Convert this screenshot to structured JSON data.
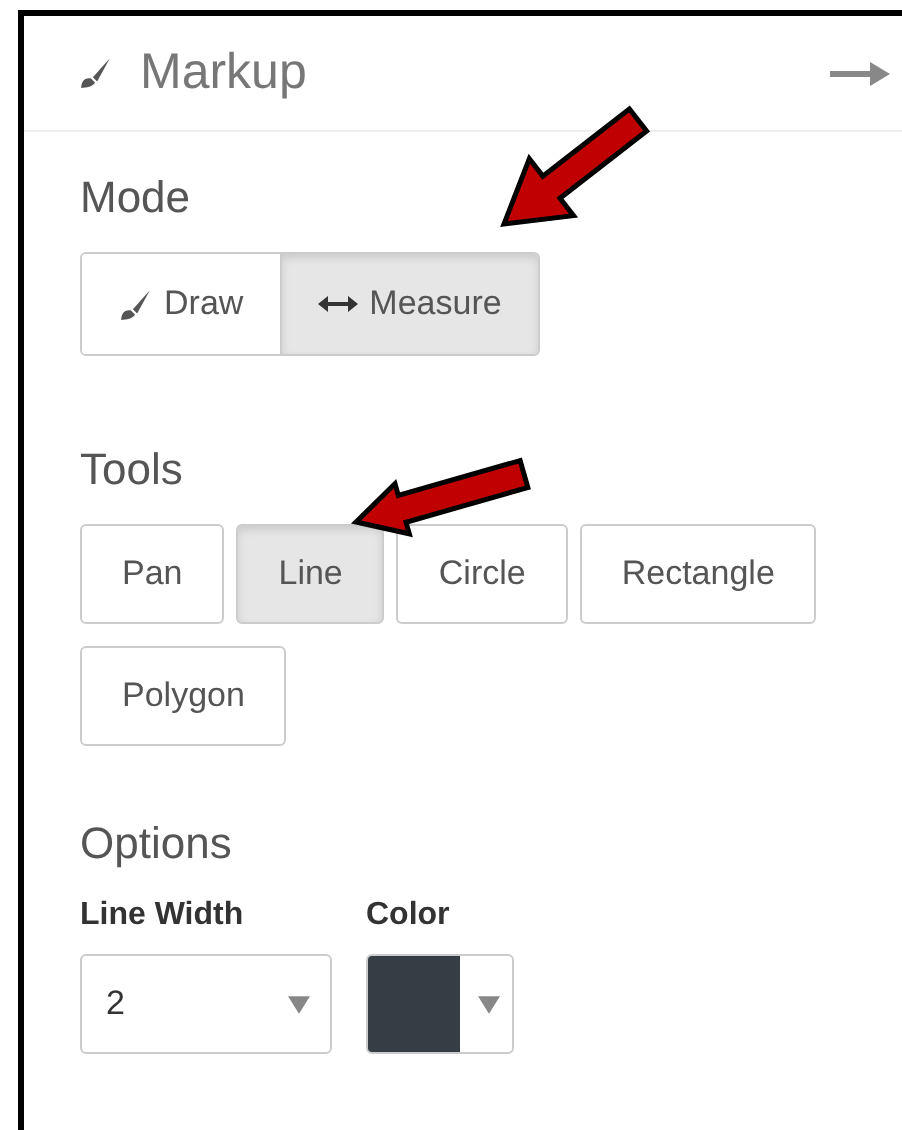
{
  "header": {
    "title": "Markup"
  },
  "mode": {
    "label": "Mode",
    "options": [
      {
        "label": "Draw",
        "kind": "brush",
        "selected": false
      },
      {
        "label": "Measure",
        "kind": "measure",
        "selected": true
      }
    ]
  },
  "tools": {
    "label": "Tools",
    "options": [
      {
        "label": "Pan",
        "selected": false
      },
      {
        "label": "Line",
        "selected": true
      },
      {
        "label": "Circle",
        "selected": false
      },
      {
        "label": "Rectangle",
        "selected": false
      },
      {
        "label": "Polygon",
        "selected": false
      }
    ]
  },
  "options": {
    "label": "Options",
    "line_width": {
      "label": "Line Width",
      "value": "2"
    },
    "color": {
      "label": "Color",
      "color": "#373d44"
    }
  }
}
